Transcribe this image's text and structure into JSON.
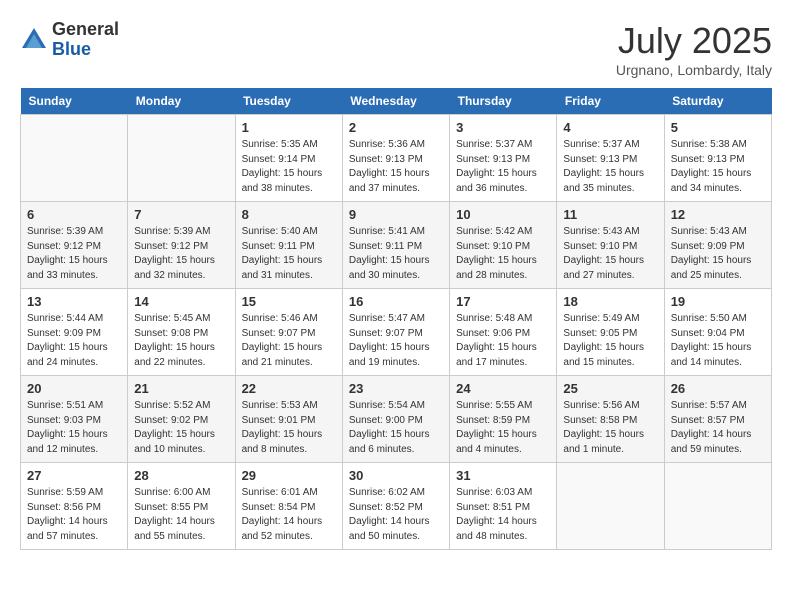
{
  "header": {
    "logo_general": "General",
    "logo_blue": "Blue",
    "month_title": "July 2025",
    "subtitle": "Urgnano, Lombardy, Italy"
  },
  "days_of_week": [
    "Sunday",
    "Monday",
    "Tuesday",
    "Wednesday",
    "Thursday",
    "Friday",
    "Saturday"
  ],
  "weeks": [
    [
      {
        "num": "",
        "info": ""
      },
      {
        "num": "",
        "info": ""
      },
      {
        "num": "1",
        "info": "Sunrise: 5:35 AM\nSunset: 9:14 PM\nDaylight: 15 hours\nand 38 minutes."
      },
      {
        "num": "2",
        "info": "Sunrise: 5:36 AM\nSunset: 9:13 PM\nDaylight: 15 hours\nand 37 minutes."
      },
      {
        "num": "3",
        "info": "Sunrise: 5:37 AM\nSunset: 9:13 PM\nDaylight: 15 hours\nand 36 minutes."
      },
      {
        "num": "4",
        "info": "Sunrise: 5:37 AM\nSunset: 9:13 PM\nDaylight: 15 hours\nand 35 minutes."
      },
      {
        "num": "5",
        "info": "Sunrise: 5:38 AM\nSunset: 9:13 PM\nDaylight: 15 hours\nand 34 minutes."
      }
    ],
    [
      {
        "num": "6",
        "info": "Sunrise: 5:39 AM\nSunset: 9:12 PM\nDaylight: 15 hours\nand 33 minutes."
      },
      {
        "num": "7",
        "info": "Sunrise: 5:39 AM\nSunset: 9:12 PM\nDaylight: 15 hours\nand 32 minutes."
      },
      {
        "num": "8",
        "info": "Sunrise: 5:40 AM\nSunset: 9:11 PM\nDaylight: 15 hours\nand 31 minutes."
      },
      {
        "num": "9",
        "info": "Sunrise: 5:41 AM\nSunset: 9:11 PM\nDaylight: 15 hours\nand 30 minutes."
      },
      {
        "num": "10",
        "info": "Sunrise: 5:42 AM\nSunset: 9:10 PM\nDaylight: 15 hours\nand 28 minutes."
      },
      {
        "num": "11",
        "info": "Sunrise: 5:43 AM\nSunset: 9:10 PM\nDaylight: 15 hours\nand 27 minutes."
      },
      {
        "num": "12",
        "info": "Sunrise: 5:43 AM\nSunset: 9:09 PM\nDaylight: 15 hours\nand 25 minutes."
      }
    ],
    [
      {
        "num": "13",
        "info": "Sunrise: 5:44 AM\nSunset: 9:09 PM\nDaylight: 15 hours\nand 24 minutes."
      },
      {
        "num": "14",
        "info": "Sunrise: 5:45 AM\nSunset: 9:08 PM\nDaylight: 15 hours\nand 22 minutes."
      },
      {
        "num": "15",
        "info": "Sunrise: 5:46 AM\nSunset: 9:07 PM\nDaylight: 15 hours\nand 21 minutes."
      },
      {
        "num": "16",
        "info": "Sunrise: 5:47 AM\nSunset: 9:07 PM\nDaylight: 15 hours\nand 19 minutes."
      },
      {
        "num": "17",
        "info": "Sunrise: 5:48 AM\nSunset: 9:06 PM\nDaylight: 15 hours\nand 17 minutes."
      },
      {
        "num": "18",
        "info": "Sunrise: 5:49 AM\nSunset: 9:05 PM\nDaylight: 15 hours\nand 15 minutes."
      },
      {
        "num": "19",
        "info": "Sunrise: 5:50 AM\nSunset: 9:04 PM\nDaylight: 15 hours\nand 14 minutes."
      }
    ],
    [
      {
        "num": "20",
        "info": "Sunrise: 5:51 AM\nSunset: 9:03 PM\nDaylight: 15 hours\nand 12 minutes."
      },
      {
        "num": "21",
        "info": "Sunrise: 5:52 AM\nSunset: 9:02 PM\nDaylight: 15 hours\nand 10 minutes."
      },
      {
        "num": "22",
        "info": "Sunrise: 5:53 AM\nSunset: 9:01 PM\nDaylight: 15 hours\nand 8 minutes."
      },
      {
        "num": "23",
        "info": "Sunrise: 5:54 AM\nSunset: 9:00 PM\nDaylight: 15 hours\nand 6 minutes."
      },
      {
        "num": "24",
        "info": "Sunrise: 5:55 AM\nSunset: 8:59 PM\nDaylight: 15 hours\nand 4 minutes."
      },
      {
        "num": "25",
        "info": "Sunrise: 5:56 AM\nSunset: 8:58 PM\nDaylight: 15 hours\nand 1 minute."
      },
      {
        "num": "26",
        "info": "Sunrise: 5:57 AM\nSunset: 8:57 PM\nDaylight: 14 hours\nand 59 minutes."
      }
    ],
    [
      {
        "num": "27",
        "info": "Sunrise: 5:59 AM\nSunset: 8:56 PM\nDaylight: 14 hours\nand 57 minutes."
      },
      {
        "num": "28",
        "info": "Sunrise: 6:00 AM\nSunset: 8:55 PM\nDaylight: 14 hours\nand 55 minutes."
      },
      {
        "num": "29",
        "info": "Sunrise: 6:01 AM\nSunset: 8:54 PM\nDaylight: 14 hours\nand 52 minutes."
      },
      {
        "num": "30",
        "info": "Sunrise: 6:02 AM\nSunset: 8:52 PM\nDaylight: 14 hours\nand 50 minutes."
      },
      {
        "num": "31",
        "info": "Sunrise: 6:03 AM\nSunset: 8:51 PM\nDaylight: 14 hours\nand 48 minutes."
      },
      {
        "num": "",
        "info": ""
      },
      {
        "num": "",
        "info": ""
      }
    ]
  ]
}
